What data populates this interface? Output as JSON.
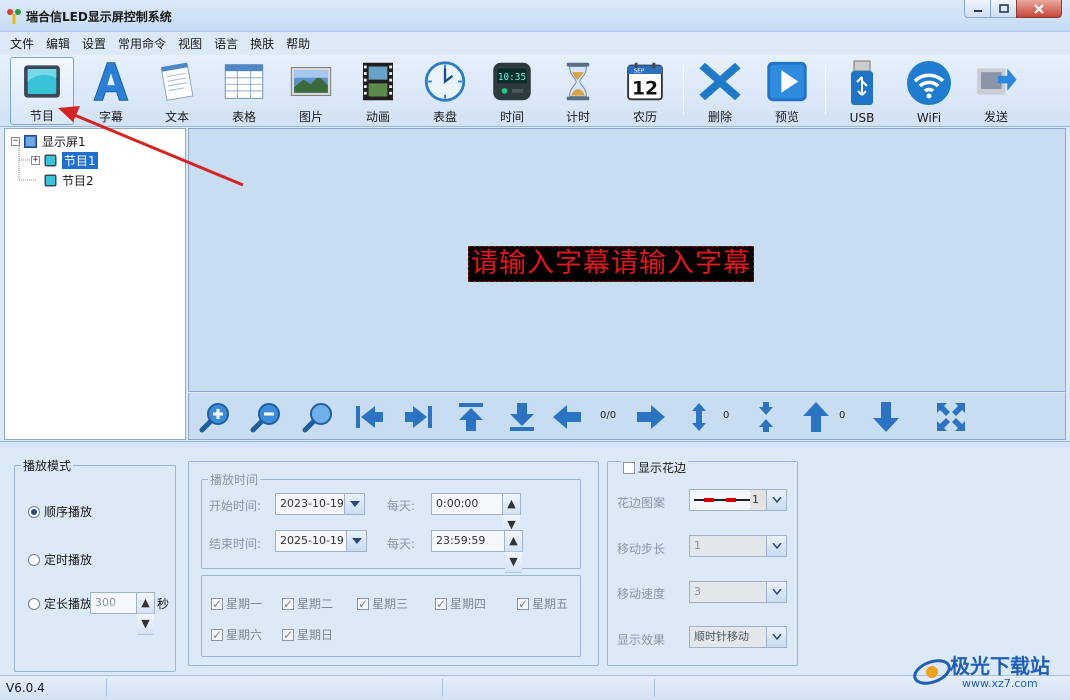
{
  "window": {
    "title": "瑞合信LED显示屏控制系统"
  },
  "menu": [
    "文件",
    "编辑",
    "设置",
    "常用命令",
    "视图",
    "语言",
    "换肤",
    "帮助"
  ],
  "toolbar": {
    "program": "节目",
    "subtitle": "字幕",
    "text": "文本",
    "table": "表格",
    "picture": "图片",
    "animation": "动画",
    "clock": "表盘",
    "time": "时间",
    "timer": "计时",
    "calendar": "农历",
    "delete": "删除",
    "preview": "预览",
    "usb": "USB",
    "wifi": "WiFi",
    "send": "发送",
    "clock_digits": "10:35",
    "calendar_month": "SEP",
    "calendar_day": "12"
  },
  "tree": {
    "screen": "显示屏1",
    "programs": [
      "节目1",
      "节目2"
    ]
  },
  "canvas": {
    "led_text": "请输入字幕请输入字幕"
  },
  "nav": {
    "page": "0/0",
    "v_count": "0",
    "up_count": "0"
  },
  "play_mode": {
    "legend": "播放模式",
    "sequential": "顺序播放",
    "scheduled": "定时播放",
    "duration": "定长播放",
    "duration_value": "300",
    "duration_unit": "秒"
  },
  "play_time": {
    "legend": "播放时间",
    "start_label": "开始时间:",
    "start_date": "2023-10-19",
    "end_label": "结束时间:",
    "end_date": "2025-10-19",
    "daily_label": "每天:",
    "daily_start": "0:00:00",
    "daily_end": "23:59:59"
  },
  "weekdays": [
    "星期一",
    "星期二",
    "星期三",
    "星期四",
    "星期五",
    "星期六",
    "星期日"
  ],
  "border": {
    "legend": "显示花边",
    "pattern_label": "花边图案",
    "pattern_value": "1",
    "step_label": "移动步长",
    "step_value": "1",
    "speed_label": "移动速度",
    "speed_value": "3",
    "effect_label": "显示效果",
    "effect_value": "顺时针移动"
  },
  "status": {
    "version": "V6.0.4"
  },
  "watermark": {
    "title": "极光下载站",
    "url": "www.xz7.com"
  },
  "colors": {
    "accent": "#1e6fd0",
    "led_text": "#e8141c",
    "arrow": "#d42323"
  }
}
